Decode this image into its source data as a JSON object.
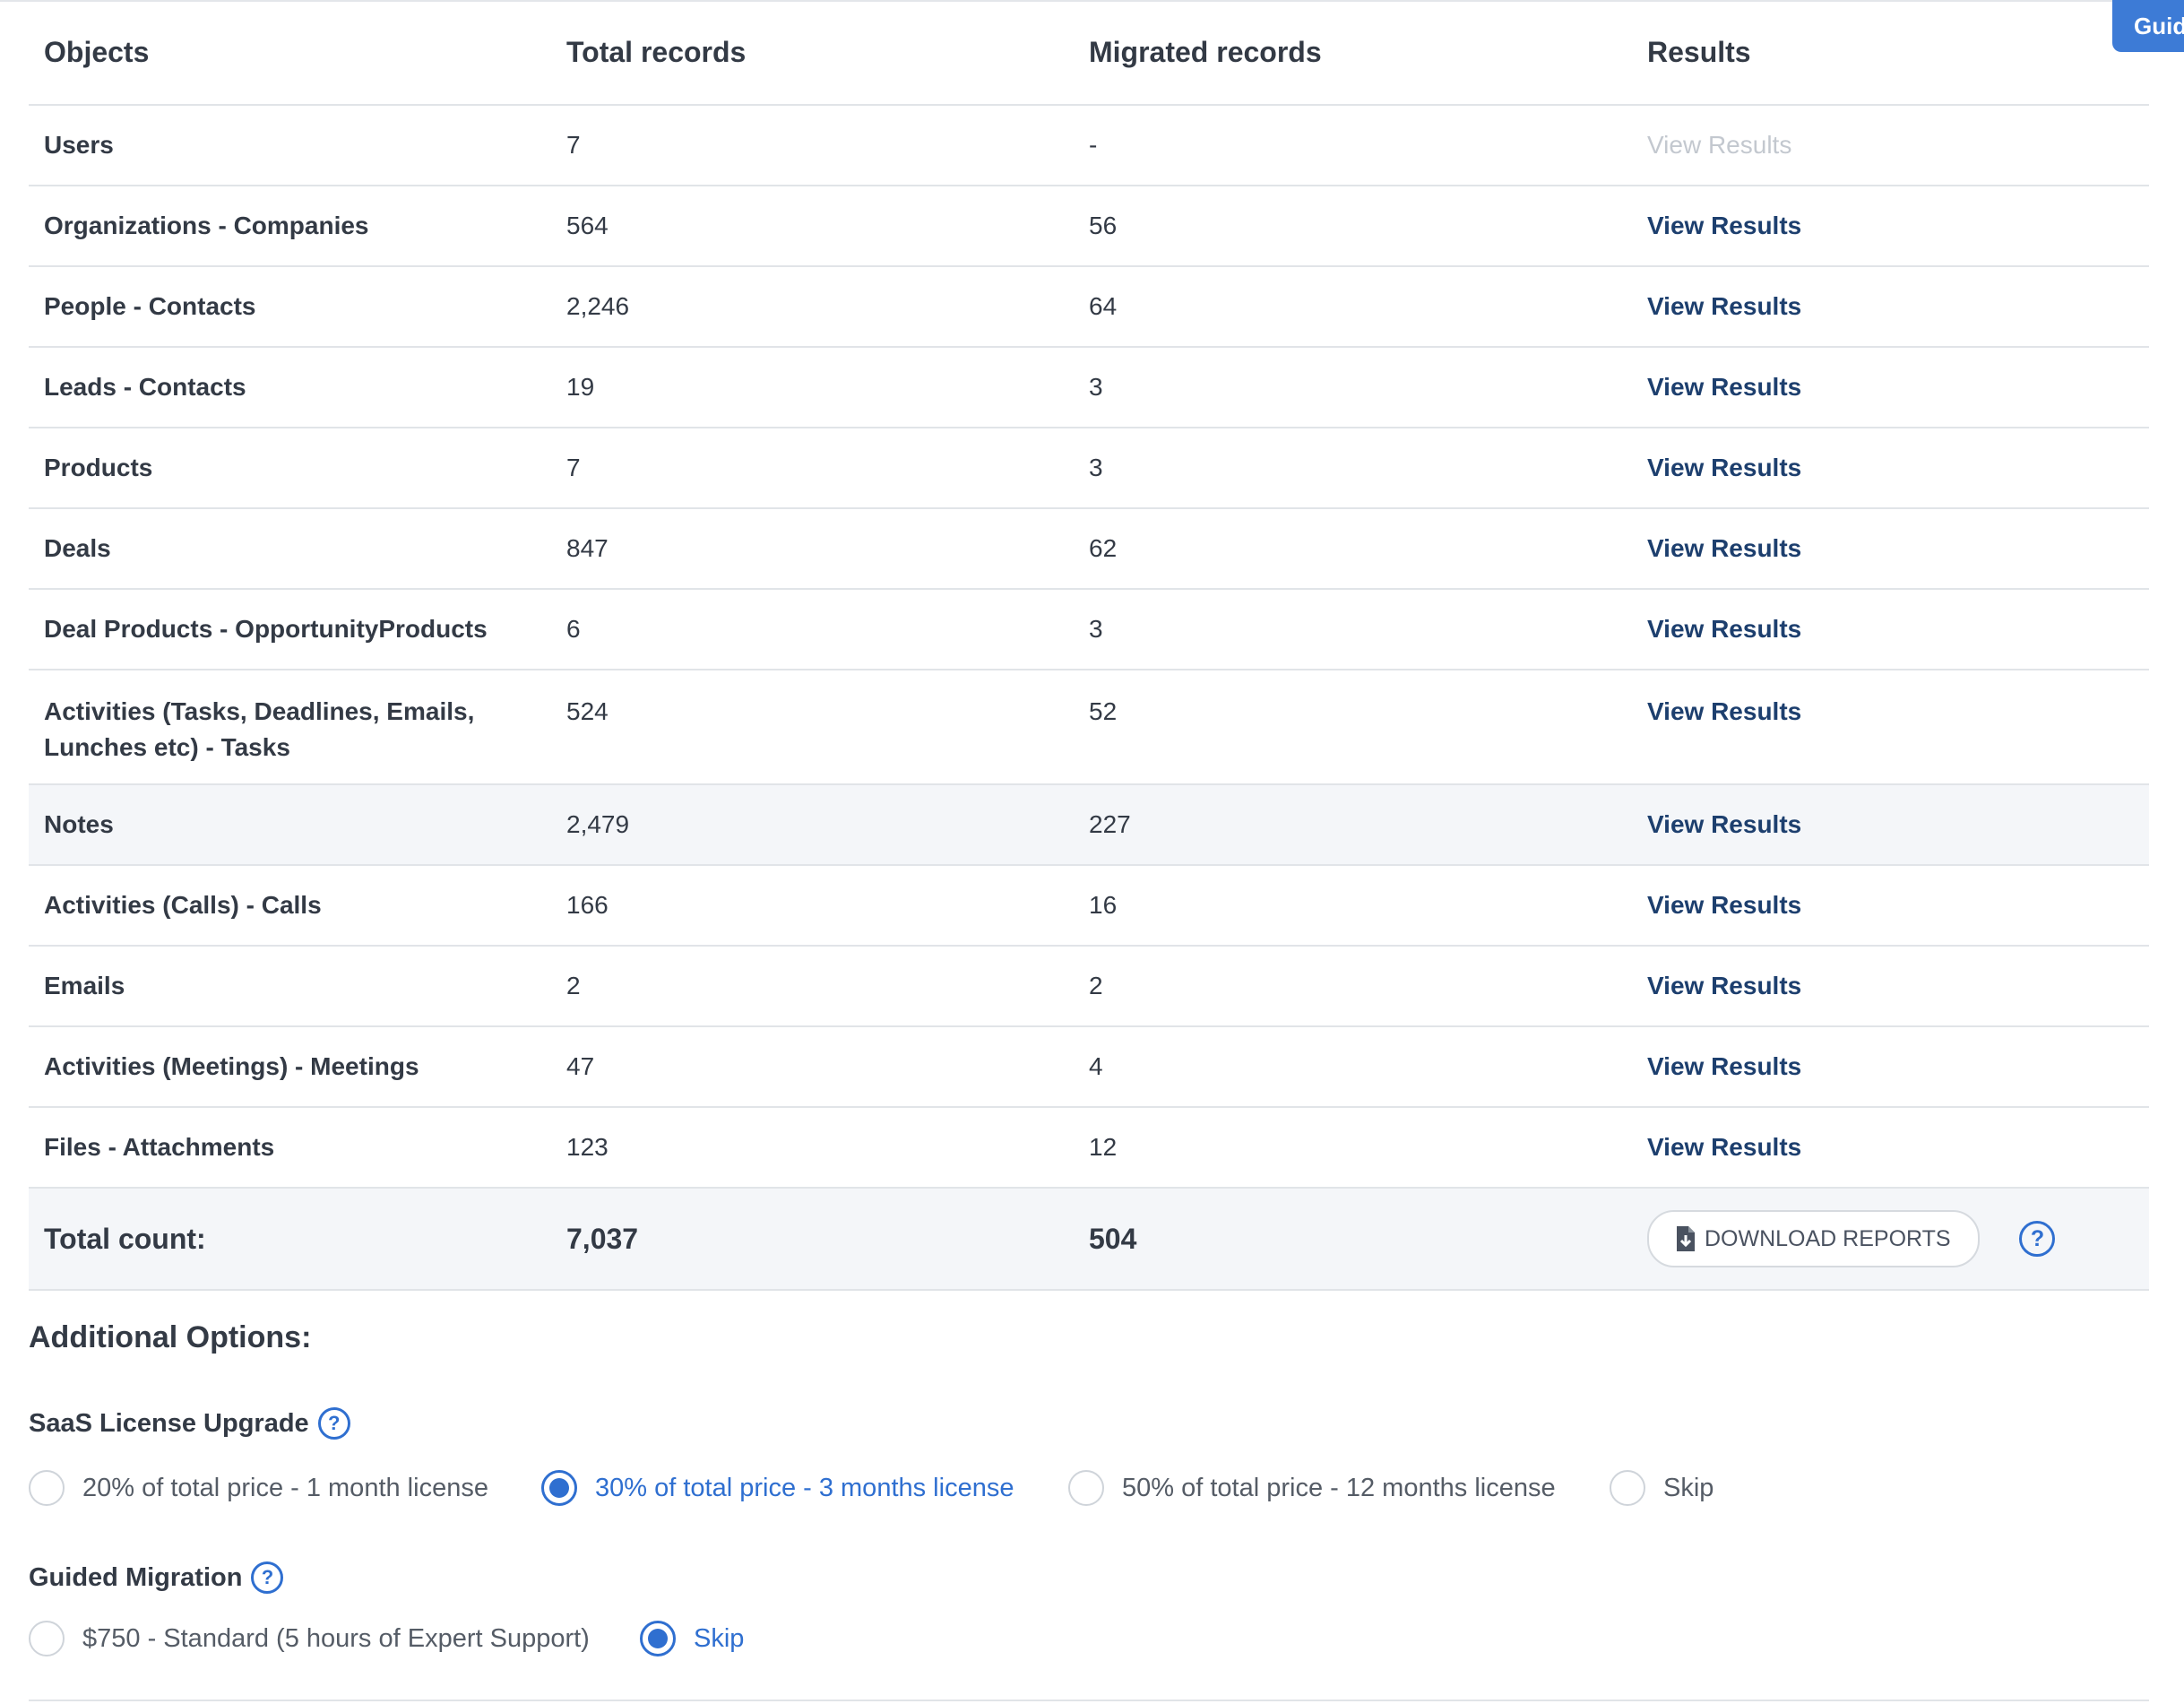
{
  "guide_tab": {
    "label": "Guided"
  },
  "table": {
    "headers": [
      "Objects",
      "Total records",
      "Migrated records",
      "Results"
    ],
    "rows": [
      {
        "object": "Users",
        "total": "7",
        "migrated": "-",
        "result": "View Results"
      },
      {
        "object": "Organizations - Companies",
        "total": "564",
        "migrated": "56",
        "result": "View Results"
      },
      {
        "object": "People - Contacts",
        "total": "2,246",
        "migrated": "64",
        "result": "View Results"
      },
      {
        "object": "Leads - Contacts",
        "total": "19",
        "migrated": "3",
        "result": "View Results"
      },
      {
        "object": "Products",
        "total": "7",
        "migrated": "3",
        "result": "View Results"
      },
      {
        "object": "Deals",
        "total": "847",
        "migrated": "62",
        "result": "View Results"
      },
      {
        "object": "Deal Products - OpportunityProducts",
        "total": "6",
        "migrated": "3",
        "result": "View Results"
      },
      {
        "object": "Activities (Tasks, Deadlines, Emails, Lunches etc) - Tasks",
        "total": "524",
        "migrated": "52",
        "result": "View Results"
      },
      {
        "object": "Notes",
        "total": "2,479",
        "migrated": "227",
        "result": "View Results"
      },
      {
        "object": "Activities (Calls) - Calls",
        "total": "166",
        "migrated": "16",
        "result": "View Results"
      },
      {
        "object": "Emails",
        "total": "2",
        "migrated": "2",
        "result": "View Results"
      },
      {
        "object": "Activities (Meetings) - Meetings",
        "total": "47",
        "migrated": "4",
        "result": "View Results"
      },
      {
        "object": "Files - Attachments",
        "total": "123",
        "migrated": "12",
        "result": "View Results"
      }
    ],
    "total": {
      "label": "Total count:",
      "total": "7,037",
      "migrated": "504",
      "download_label": "DOWNLOAD REPORTS"
    }
  },
  "additional_options": {
    "title": "Additional Options:",
    "saas": {
      "title": "SaaS License Upgrade",
      "options": [
        {
          "label": "20% of total price - 1 month license",
          "selected": false
        },
        {
          "label": "30% of total price - 3 months license",
          "selected": true
        },
        {
          "label": "50% of total price - 12 months license",
          "selected": false
        },
        {
          "label": "Skip",
          "selected": false
        }
      ]
    },
    "guided": {
      "title": "Guided Migration",
      "options": [
        {
          "label": "$750 - Standard (5 hours of Expert Support)",
          "selected": false
        },
        {
          "label": "Skip",
          "selected": true
        }
      ]
    }
  },
  "colors": {
    "accent": "#2f6fd0",
    "link": "#1d3f6e",
    "disabled": "#c3c8cf",
    "row_highlight": "#f4f6f9"
  },
  "icons": {
    "help": "question-circle-icon",
    "download": "file-download-icon"
  },
  "help_glyph": "?"
}
